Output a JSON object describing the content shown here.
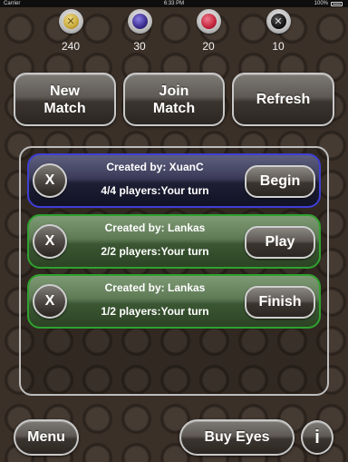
{
  "status_bar": {
    "carrier": "Carrier",
    "time": "6:33 PM",
    "battery": "100%"
  },
  "eyes": [
    {
      "name": "gold",
      "count": "240",
      "icon_symbol": "✕",
      "color": "#c8a83a"
    },
    {
      "name": "purple",
      "count": "30",
      "icon_symbol": "",
      "color": "#3a2c8c"
    },
    {
      "name": "red",
      "count": "20",
      "icon_symbol": "",
      "color": "#c2243c"
    },
    {
      "name": "black",
      "count": "10",
      "icon_symbol": "✕",
      "color": "#151515"
    }
  ],
  "top_buttons": {
    "new_match": "New Match",
    "join_match": "Join Match",
    "refresh": "Refresh"
  },
  "matches": [
    {
      "close_label": "X",
      "creator": "Created by: XuanC",
      "status": "4/4 players:Your turn",
      "action": "Begin",
      "color": "blue"
    },
    {
      "close_label": "X",
      "creator": "Created by: Lankas",
      "status": "2/2 players:Your turn",
      "action": "Play",
      "color": "green"
    },
    {
      "close_label": "X",
      "creator": "Created by: Lankas",
      "status": "1/2 players:Your turn",
      "action": "Finish",
      "color": "green"
    }
  ],
  "bottom_buttons": {
    "menu": "Menu",
    "buy_eyes": "Buy Eyes",
    "info": "i"
  }
}
